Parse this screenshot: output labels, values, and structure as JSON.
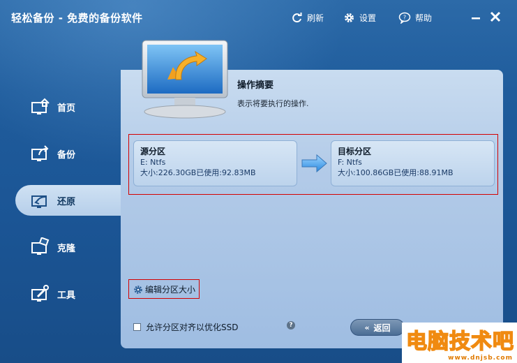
{
  "window": {
    "title": "轻松备份 - 免费的备份软件",
    "refresh_label": "刷新",
    "settings_label": "设置",
    "help_label": "帮助"
  },
  "sidebar": {
    "items": [
      {
        "label": "首页",
        "icon": "home-icon",
        "active": false
      },
      {
        "label": "备份",
        "icon": "backup-icon",
        "active": false
      },
      {
        "label": "还原",
        "icon": "restore-icon",
        "active": true
      },
      {
        "label": "克隆",
        "icon": "clone-icon",
        "active": false
      },
      {
        "label": "工具",
        "icon": "tools-icon",
        "active": false
      }
    ]
  },
  "summary": {
    "title": "操作摘要",
    "description": "表示将要执行的操作."
  },
  "source": {
    "title": "源分区",
    "drive": "E: Ntfs",
    "size": "大小:226.30GB已使用:92.83MB"
  },
  "target": {
    "title": "目标分区",
    "drive": "F: Ntfs",
    "size": "大小:100.86GB已使用:88.91MB"
  },
  "options": {
    "edit_partition": "编辑分区大小",
    "align_ssd": "允许分区对齐以优化SSD",
    "help": "?"
  },
  "buttons": {
    "back": "返回"
  },
  "watermark": {
    "text": "电脑技术吧",
    "url": "www.dnjsb.com"
  },
  "colors": {
    "accent": "#1f5c9c",
    "panel": "#b3cbe8",
    "highlight": "#d40000"
  }
}
